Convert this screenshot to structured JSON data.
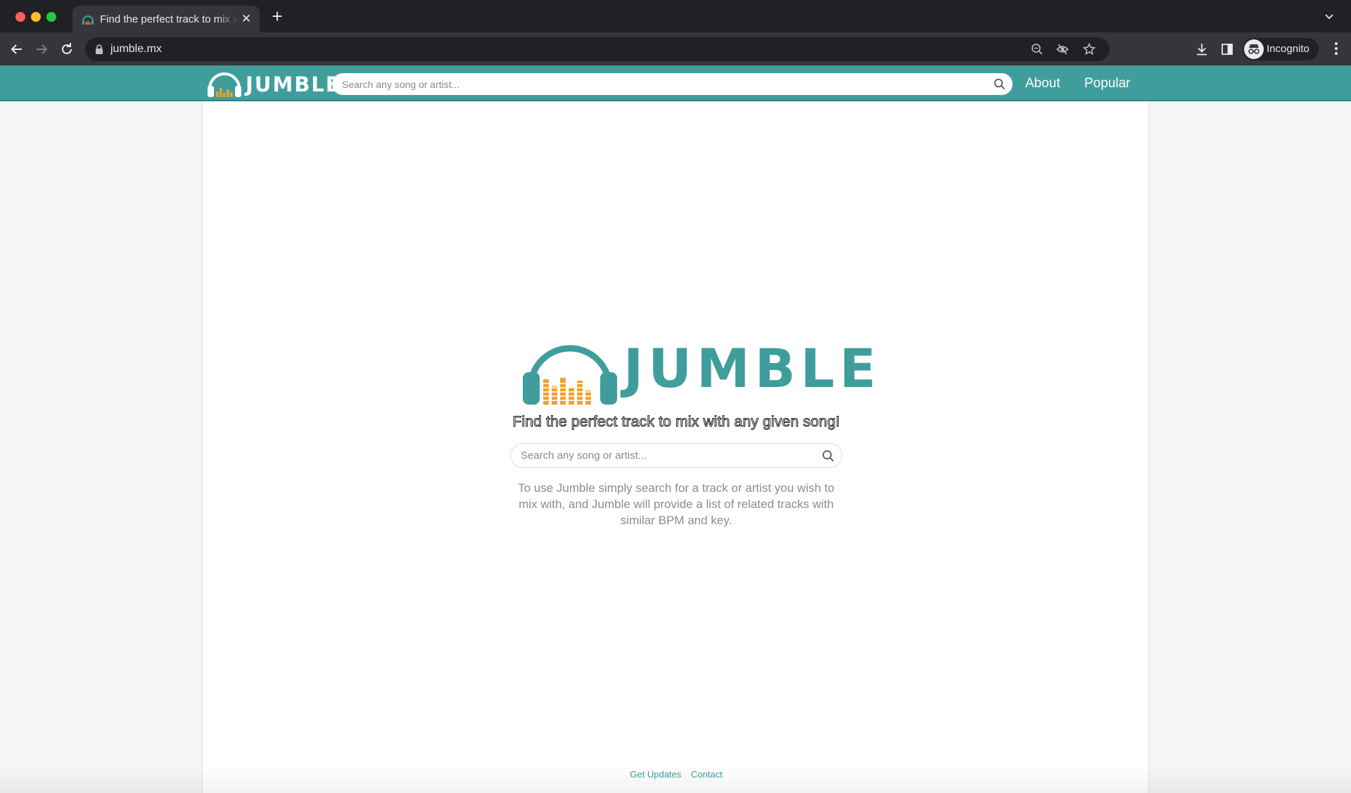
{
  "browser": {
    "tab_title": "Find the perfect track to mix with any given song!",
    "url": "jumble.mx",
    "profile_label": "Incognito"
  },
  "header": {
    "logo_text": "JUMBLE",
    "search_placeholder": "Search any song or artist...",
    "nav": {
      "about": "About",
      "popular": "Popular"
    }
  },
  "hero": {
    "logo_text": "JUMBLE",
    "tagline": "Find the perfect track to mix with any given song!",
    "search_placeholder": "Search any song or artist...",
    "description": "To use Jumble simply search for a track or artist you wish to mix with, and Jumble will provide a list of related tracks with similar BPM and key."
  },
  "footer": {
    "get_updates": "Get Updates",
    "contact": "Contact"
  },
  "colors": {
    "brand_teal": "#3f9e9c",
    "equalizer_orange": "#f0a030"
  },
  "icons": [
    "headphones-logo-icon",
    "search-icon",
    "lock-icon",
    "back-icon",
    "forward-icon",
    "reload-icon",
    "zoom-icon",
    "eye-off-icon",
    "star-icon",
    "download-icon",
    "sidebar-icon",
    "incognito-icon",
    "more-icon",
    "close-icon",
    "plus-icon",
    "chevron-down-icon"
  ]
}
